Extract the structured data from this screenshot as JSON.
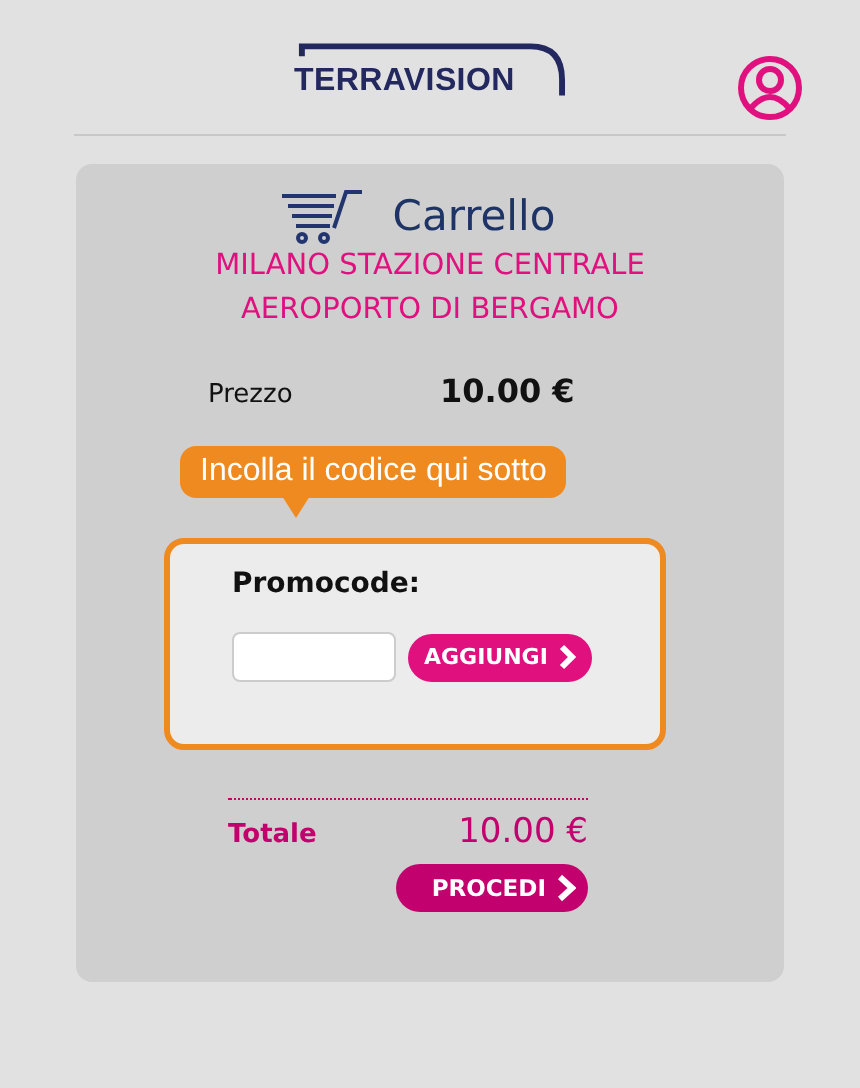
{
  "header": {
    "logo": "TERRAVISION"
  },
  "cart": {
    "title": "Carrello",
    "route": [
      "MILANO STAZIONE CENTRALE",
      "AEROPORTO DI BERGAMO"
    ],
    "price_label": "Prezzo",
    "price": "10.00 €",
    "tooltip": "Incolla il codice qui sotto",
    "promo": {
      "label": "Promocode:",
      "button": "AGGIUNGI"
    },
    "total_label": "Totale",
    "total": "10.00 €",
    "proceed": "PROCEDI"
  }
}
